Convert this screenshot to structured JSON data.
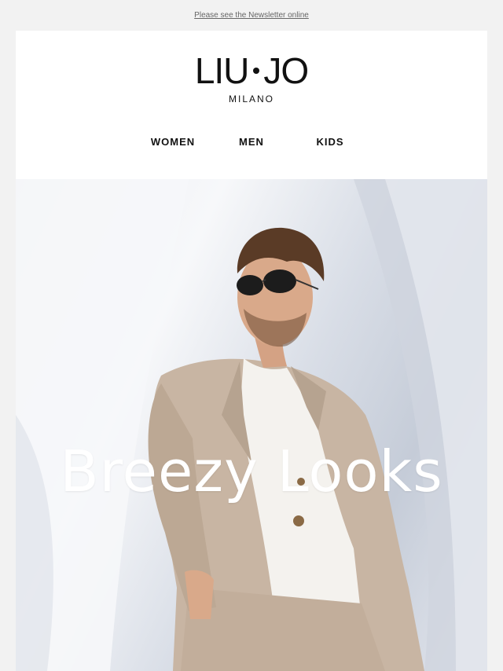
{
  "header": {
    "view_online_link": "Please see the Newsletter online"
  },
  "brand": {
    "logo_left": "LIU",
    "logo_right": "JO",
    "logo_sub": "MILANO"
  },
  "nav": {
    "items": [
      "WOMEN",
      "MEN",
      "KIDS"
    ]
  },
  "hero": {
    "title": "Breezy Looks"
  }
}
